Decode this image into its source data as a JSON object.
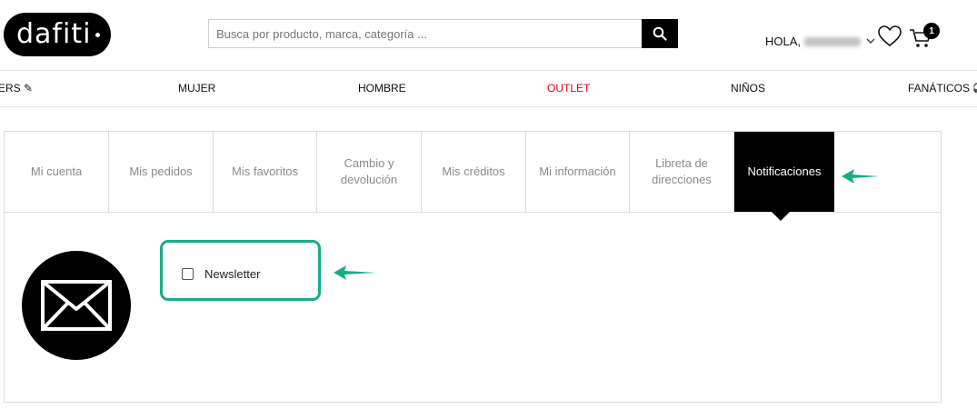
{
  "header": {
    "logo_text": "dafiti",
    "search": {
      "placeholder": "Busca por producto, marca, categoría ...",
      "value": ""
    },
    "search_icon": "search-icon",
    "greeting_prefix": "HOLA,",
    "wishlist_icon": "heart-icon",
    "cart_icon": "cart-icon",
    "cart_count": "1"
  },
  "nav": {
    "items": [
      {
        "label": "ERS ✎"
      },
      {
        "label": "MUJER"
      },
      {
        "label": "HOMBRE"
      },
      {
        "label": "OUTLET"
      },
      {
        "label": "NIÑOS"
      },
      {
        "label": "FANÁTICOS ⚽"
      }
    ]
  },
  "account": {
    "tabs": [
      {
        "label": "Mi cuenta"
      },
      {
        "label": "Mis pedidos"
      },
      {
        "label": "Mis favoritos"
      },
      {
        "label": "Cambio y devolución"
      },
      {
        "label": "Mis créditos"
      },
      {
        "label": "Mi información"
      },
      {
        "label": "Libreta de direcciones"
      },
      {
        "label": "Notificaciones",
        "active": true
      }
    ],
    "newsletter_label": "Newsletter",
    "newsletter_checked": false,
    "mail_icon": "envelope-icon"
  },
  "colors": {
    "brand": "#000000",
    "outlet": "#e0001a",
    "highlight": "#1aab8a"
  }
}
